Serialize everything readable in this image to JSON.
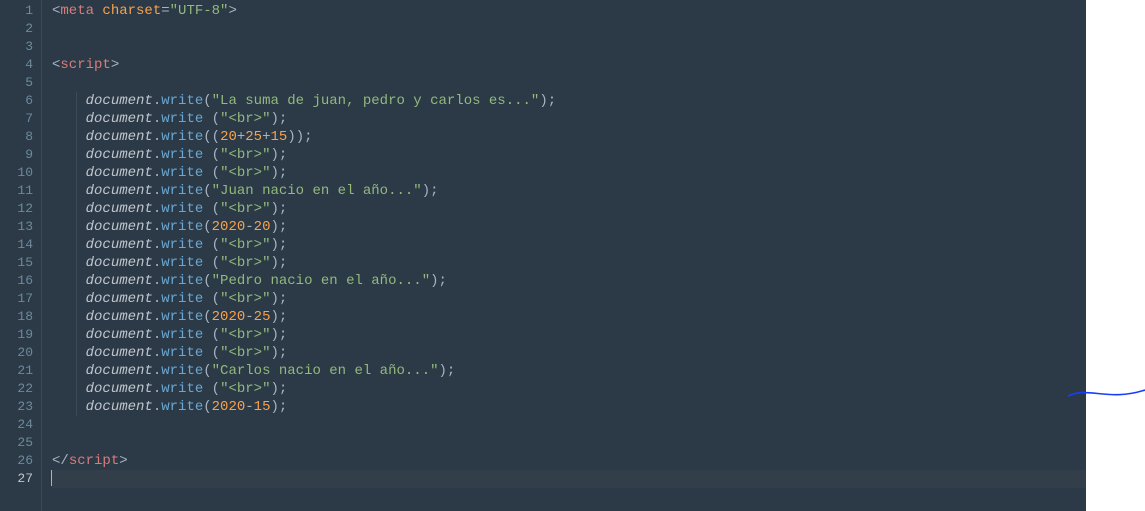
{
  "lines": [
    {
      "n": 1,
      "indent": 0,
      "kind": "meta_open"
    },
    {
      "n": 2,
      "indent": 0,
      "kind": "blank"
    },
    {
      "n": 3,
      "indent": 0,
      "kind": "blank"
    },
    {
      "n": 4,
      "indent": 0,
      "kind": "script_open"
    },
    {
      "n": 5,
      "indent": 0,
      "kind": "blank"
    },
    {
      "n": 6,
      "indent": 2,
      "kind": "write_str",
      "space_before_paren": false,
      "str": "\"La suma de juan, pedro y carlos es...\""
    },
    {
      "n": 7,
      "indent": 2,
      "kind": "write_str",
      "space_before_paren": true,
      "str": "\"<br>\""
    },
    {
      "n": 8,
      "indent": 2,
      "kind": "write_expr_paren",
      "space_before_paren": false,
      "nums": [
        "20",
        "25",
        "15"
      ],
      "ops": [
        "+",
        "+"
      ]
    },
    {
      "n": 9,
      "indent": 2,
      "kind": "write_str",
      "space_before_paren": true,
      "str": "\"<br>\""
    },
    {
      "n": 10,
      "indent": 2,
      "kind": "write_str",
      "space_before_paren": true,
      "str": "\"<br>\""
    },
    {
      "n": 11,
      "indent": 2,
      "kind": "write_str",
      "space_before_paren": false,
      "str": "\"Juan nacio en el año...\""
    },
    {
      "n": 12,
      "indent": 2,
      "kind": "write_str",
      "space_before_paren": true,
      "str": "\"<br>\""
    },
    {
      "n": 13,
      "indent": 2,
      "kind": "write_expr",
      "space_before_paren": false,
      "nums": [
        "2020",
        "20"
      ],
      "ops": [
        "-"
      ]
    },
    {
      "n": 14,
      "indent": 2,
      "kind": "write_str",
      "space_before_paren": true,
      "str": "\"<br>\""
    },
    {
      "n": 15,
      "indent": 2,
      "kind": "write_str",
      "space_before_paren": true,
      "str": "\"<br>\""
    },
    {
      "n": 16,
      "indent": 2,
      "kind": "write_str",
      "space_before_paren": false,
      "str": "\"Pedro nacio en el año...\""
    },
    {
      "n": 17,
      "indent": 2,
      "kind": "write_str",
      "space_before_paren": true,
      "str": "\"<br>\""
    },
    {
      "n": 18,
      "indent": 2,
      "kind": "write_expr",
      "space_before_paren": false,
      "nums": [
        "2020",
        "25"
      ],
      "ops": [
        "-"
      ]
    },
    {
      "n": 19,
      "indent": 2,
      "kind": "write_str",
      "space_before_paren": true,
      "str": "\"<br>\""
    },
    {
      "n": 20,
      "indent": 2,
      "kind": "write_str",
      "space_before_paren": true,
      "str": "\"<br>\""
    },
    {
      "n": 21,
      "indent": 2,
      "kind": "write_str",
      "space_before_paren": false,
      "str": "\"Carlos nacio en el año...\""
    },
    {
      "n": 22,
      "indent": 2,
      "kind": "write_str",
      "space_before_paren": true,
      "str": "\"<br>\""
    },
    {
      "n": 23,
      "indent": 2,
      "kind": "write_expr",
      "space_before_paren": false,
      "nums": [
        "2020",
        "15"
      ],
      "ops": [
        "-"
      ]
    },
    {
      "n": 24,
      "indent": 0,
      "kind": "blank"
    },
    {
      "n": 25,
      "indent": 0,
      "kind": "blank"
    },
    {
      "n": 26,
      "indent": 0,
      "kind": "script_close"
    },
    {
      "n": 27,
      "indent": 0,
      "kind": "active_blank"
    }
  ],
  "tokens": {
    "meta_tag": "meta",
    "meta_attr": "charset",
    "meta_val": "\"UTF-8\"",
    "script_tag": "script",
    "obj": "document",
    "method": "write"
  }
}
